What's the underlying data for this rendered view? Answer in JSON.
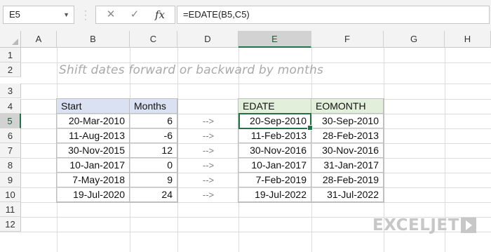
{
  "formula_bar": {
    "name_box": "E5",
    "cancel_icon": "✕",
    "confirm_icon": "✓",
    "fx_label": "fx",
    "formula": "=EDATE(B5,C5)"
  },
  "columns": [
    "A",
    "B",
    "C",
    "D",
    "E",
    "F",
    "G",
    "H"
  ],
  "rows": [
    "1",
    "2",
    "3",
    "4",
    "5",
    "6",
    "7",
    "8",
    "9",
    "10",
    "11",
    "12"
  ],
  "selected_cell": {
    "column": "E",
    "row": "5"
  },
  "sheet_title": "Shift dates forward or backward by months",
  "input_table": {
    "headers": [
      "Start",
      "Months"
    ],
    "rows": [
      [
        "20-Mar-2010",
        "6"
      ],
      [
        "11-Aug-2013",
        "-6"
      ],
      [
        "30-Nov-2015",
        "12"
      ],
      [
        "10-Jan-2017",
        "0"
      ],
      [
        "7-May-2018",
        "9"
      ],
      [
        "19-Jul-2020",
        "24"
      ]
    ]
  },
  "arrows": [
    "-->",
    "-->",
    "-->",
    "-->",
    "-->",
    "-->"
  ],
  "output_table": {
    "headers": [
      "EDATE",
      "EOMONTH"
    ],
    "rows": [
      [
        "20-Sep-2010",
        "30-Sep-2010"
      ],
      [
        "11-Feb-2013",
        "28-Feb-2013"
      ],
      [
        "30-Nov-2016",
        "30-Nov-2016"
      ],
      [
        "10-Jan-2017",
        "31-Jan-2017"
      ],
      [
        "7-Feb-2019",
        "28-Feb-2019"
      ],
      [
        "19-Jul-2022",
        "31-Jul-2022"
      ]
    ]
  },
  "logo": {
    "text": "EXCELJET"
  },
  "colors": {
    "accent": "#217346",
    "header_blue": "#d9e1f2",
    "header_green": "#e2efda",
    "logo": "#c7c7c7"
  }
}
